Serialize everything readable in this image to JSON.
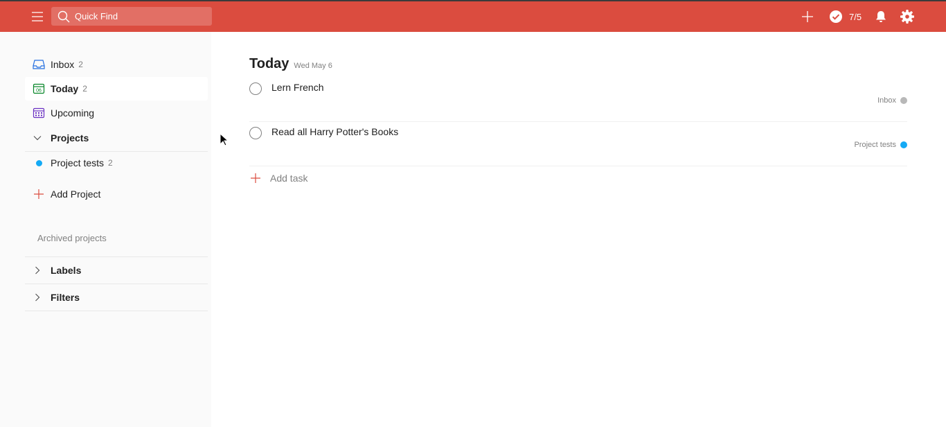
{
  "topbar": {
    "search_placeholder": "Quick Find",
    "karma_text": "7/5"
  },
  "sidebar": {
    "items": [
      {
        "label": "Inbox",
        "count": "2"
      },
      {
        "label": "Today",
        "count": "2"
      },
      {
        "label": "Upcoming",
        "count": ""
      }
    ],
    "projects_header": "Projects",
    "projects": [
      {
        "label": "Project tests",
        "count": "2",
        "color": "#14aaf5"
      }
    ],
    "add_project_label": "Add Project",
    "archived_label": "Archived projects",
    "labels_header": "Labels",
    "filters_header": "Filters"
  },
  "main": {
    "title": "Today",
    "date": "Wed May 6",
    "tasks": [
      {
        "content": "Lern French",
        "project": "Inbox",
        "project_color": "#b8b8b8"
      },
      {
        "content": "Read all Harry Potter's Books",
        "project": "Project tests",
        "project_color": "#14aaf5"
      }
    ],
    "add_task_label": "Add task"
  },
  "colors": {
    "brand": "#db4c3f",
    "accent_blue": "#14aaf5"
  }
}
